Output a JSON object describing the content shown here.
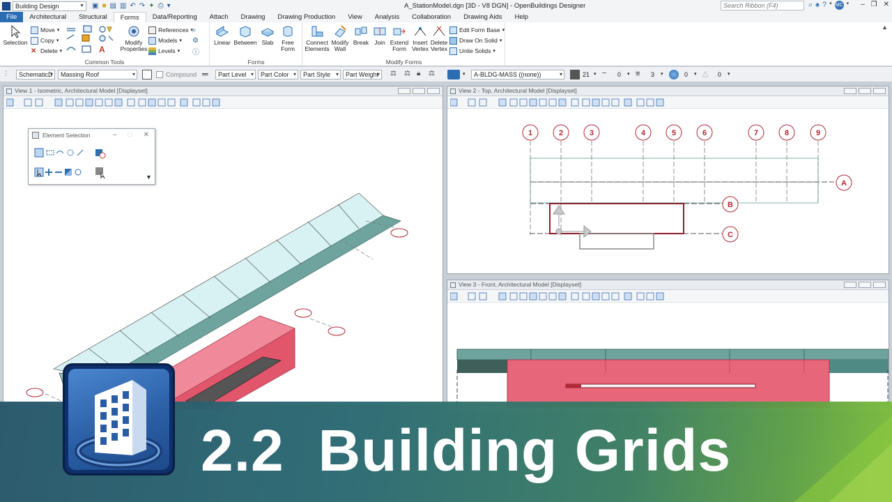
{
  "titlebar": {
    "workspace": "Building Design",
    "document_title": "A_StationModel.dgn [3D - V8 DGN] - OpenBuildings Designer",
    "search_placeholder": "Search Ribbon (F4)",
    "user_initials": "MC"
  },
  "tabs": [
    "File",
    "Architectural",
    "Structural",
    "Forms",
    "Data/Reporting",
    "Attach",
    "Drawing",
    "Drawing Production",
    "View",
    "Analysis",
    "Collaboration",
    "Drawing Aids",
    "Help"
  ],
  "active_tab": "Forms",
  "ribbon": {
    "common_tools": {
      "label": "Common Tools",
      "selection": "Selection",
      "move": "Move",
      "copy": "Copy",
      "delete": "Delete",
      "modify_properties": "Modify Properties",
      "references": "References",
      "models": "Models",
      "levels": "Levels"
    },
    "forms": {
      "label": "Forms",
      "linear": "Linear",
      "between": "Between",
      "slab": "Slab",
      "free_form": "Free Form"
    },
    "modify_forms": {
      "label": "Modify Forms",
      "connect_elements": "Connect Elements",
      "modify_wall": "Modify Wall",
      "break": "Break",
      "join": "Join",
      "extend_form": "Extend Form",
      "insert_vertex": "Insert Vertex",
      "delete_vertex": "Delete Vertex",
      "edit_form_base": "Edit Form Base",
      "draw_on_solid": "Draw On Solid",
      "unite_solids": "Unite Solids"
    }
  },
  "attributes": {
    "family": "SchematicD",
    "part": "Massing Roof",
    "compound": "Compound",
    "part_level": "Part Level",
    "part_color": "Part Color",
    "part_style": "Part Style",
    "part_weight": "Part Weight",
    "level": "A-BLDG-MASS ((none))",
    "color_value": "21",
    "style_value": "0",
    "weight_value": "3",
    "transparency_value": "0",
    "priority_value": "0"
  },
  "views": {
    "view1": "View 1 - Isometric, Architectural Model [Displayset]",
    "view2": "View 2 - Top, Architectural Model [Displayset]",
    "view3": "View 3 - Front, Architectural Model [Displayset]"
  },
  "element_selection": {
    "title": "Element Selection"
  },
  "grid": {
    "numbers": [
      "1",
      "2",
      "3",
      "4",
      "5",
      "6",
      "7",
      "8",
      "9"
    ],
    "letters": [
      "A",
      "B",
      "C"
    ]
  },
  "banner": {
    "title": "2.2  Building Grids"
  },
  "colors": {
    "ribbon_blue": "#2b6cb3",
    "mass_red": "#e8667a",
    "roof_cyan": "#d8f1f3",
    "roof_teal": "#6fa49e",
    "grid_red": "#b02a37",
    "banner_teal": "#2b6a72",
    "banner_green": "#7fbf3a"
  }
}
